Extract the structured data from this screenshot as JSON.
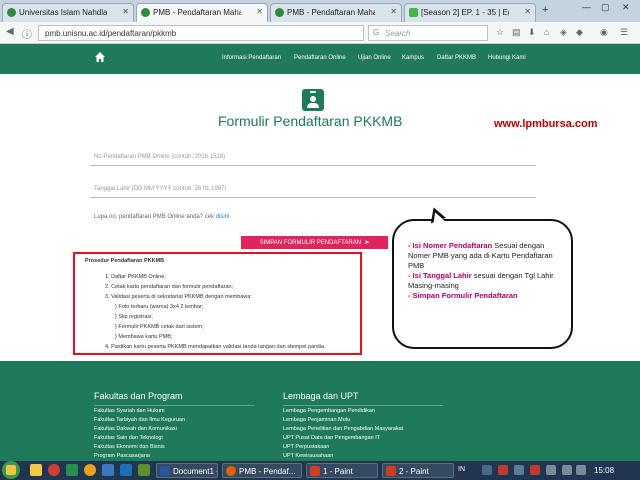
{
  "browser": {
    "tabs": [
      {
        "title": "Universitas Islam Nahdlatu...",
        "active": false,
        "favicon_color": "#2f8a3a"
      },
      {
        "title": "PMB - Pendaftaran Mahas...",
        "active": true,
        "favicon_color": "#2f8a3a"
      },
      {
        "title": "PMB - Pendaftaran Mahas...",
        "active": false,
        "favicon_color": "#2f8a3a"
      },
      {
        "title": "[Season 2] EP. 1 - 35 | Egg...",
        "active": false,
        "favicon_color": "#45b649"
      }
    ],
    "new_tab": "+",
    "window_controls": {
      "minimize": "—",
      "maximize": "▢",
      "close": "✕"
    },
    "url": "pmb.unisnu.ac.id/pendaftaran/pkkmb",
    "search_placeholder": "Search",
    "search_engine_glyph": "G"
  },
  "site": {
    "accent": "#1e7a5b",
    "menu": [
      "Informasi Pendaftaran",
      "Pendaftaran Online",
      "Ujian Online",
      "Kampus",
      "Daftar PKKMB",
      "Hubungi Kami"
    ]
  },
  "form": {
    "title": "Formulir Pendaftaran PKKMB",
    "watermark": "www.lpmbursa.com",
    "field1_placeholder": "No Pendaftaran PMB Online (contoh: 2016.1518)",
    "field2_placeholder": "Tanggal Lahir (DD MM YYYY contoh: 26 01 1997)",
    "forgot_text": "Lupa no. pendaftaran PMB Online anda? cek ",
    "forgot_link": "disini",
    "submit_label": "SIMPAN FORMULIR PENDAFTARAN",
    "submit_color": "#e0245e"
  },
  "procedure": {
    "title": "Prosedur Pendaftaran PKKMB",
    "lines": [
      "1. Daftar PKKMB Online;",
      "2. Cetak kartu pendaftaran dan formulir pendaftaran;",
      "3. Validasi peserta di sekretariat PKKMB dengan membawa:",
      "} Foto terbaru (warna) 3x4 2 lembar;",
      "} Slip registrasi;",
      "} Formulir PKKMB cetak dari sistem;",
      "} Membawa kartu PMB;",
      "4. Pastikan kartu peserta PKKMB mendapatkan validasi tanda tangan dan stempel panitia."
    ]
  },
  "annotation": {
    "item1_bold": "- Isi Nomer Pendaftaran",
    "item1_rest": " Sesuai dengan Nomer PMB yang ada di Kartu Pendaftaran PMB",
    "item2_bold": "- Isi Tanggal Lahir",
    "item2_rest": " sesuai dengan Tgl Lahir Masing-masing",
    "item3_bold": "- Simpan Formulir Pendaftaran"
  },
  "footer": {
    "col1_title": "Fakultas dan Program",
    "col1_links": [
      "Fakultas Syariah dan Hukum",
      "Fakultas Tarbiyah dan Ilmu Keguruan",
      "Fakultas Dakwah dan Komunikasi",
      "Fakultas Sain dan Teknologi",
      "Fakultas Ekonomi dan Bisnis",
      "Program Pascasarjana"
    ],
    "col2_title": "Lembaga dan UPT",
    "col2_links": [
      "Lembaga Pengembangan Pendidikan",
      "Lembaga Penjaminan Mutu",
      "Lembaga Penelitian dan Pengabdian Masyarakat",
      "UPT Pusat Data dan Pengembangan IT",
      "UPT Perpustakaan",
      "UPT Kewirausahaan"
    ]
  },
  "taskbar": {
    "apps": [
      {
        "label": "Document1 - ...",
        "color": "#2b5797"
      },
      {
        "label": "PMB - Pendaf...",
        "color": "#e66000"
      },
      {
        "label": "1 - Paint",
        "color": "#d04020"
      },
      {
        "label": "2 - Paint",
        "color": "#d04020"
      }
    ],
    "lang": "IN",
    "time": "15:08"
  }
}
